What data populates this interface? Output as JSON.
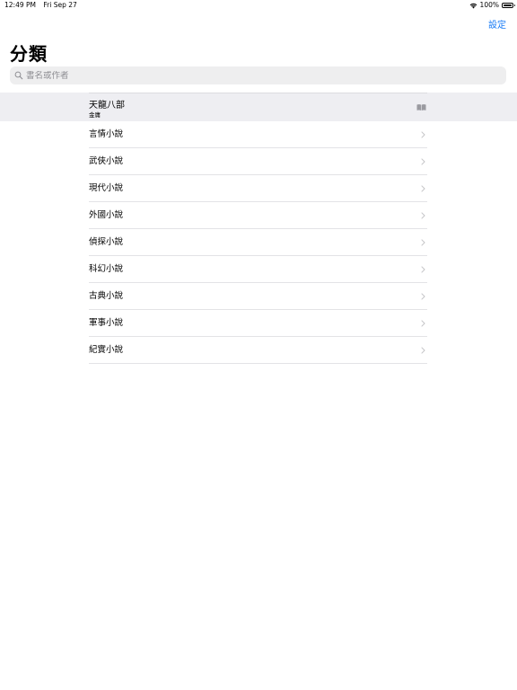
{
  "status_bar": {
    "time": "12:49 PM",
    "date": "Fri Sep 27",
    "battery": "100%"
  },
  "nav": {
    "settings_label": "設定",
    "title": "分類"
  },
  "search": {
    "placeholder": "書名或作者",
    "value": ""
  },
  "book": {
    "title": "天龍八部",
    "author": "金庸"
  },
  "categories": [
    {
      "label": "言情小說"
    },
    {
      "label": "武俠小說"
    },
    {
      "label": "現代小說"
    },
    {
      "label": "外國小說"
    },
    {
      "label": "偵探小說"
    },
    {
      "label": "科幻小說"
    },
    {
      "label": "古典小說"
    },
    {
      "label": "軍事小說"
    },
    {
      "label": "紀實小說"
    }
  ],
  "icons": {
    "search": "search-icon",
    "book": "book-icon",
    "chevron": "chevron-right-icon",
    "wifi": "wifi-icon",
    "battery": "battery-icon"
  },
  "colors": {
    "accent": "#1a7cf6",
    "search_bg": "#eeeeef",
    "selected_row_bg": "#eeeef2",
    "separator": "#e3e3e6",
    "chevron": "#c4c4c7"
  }
}
